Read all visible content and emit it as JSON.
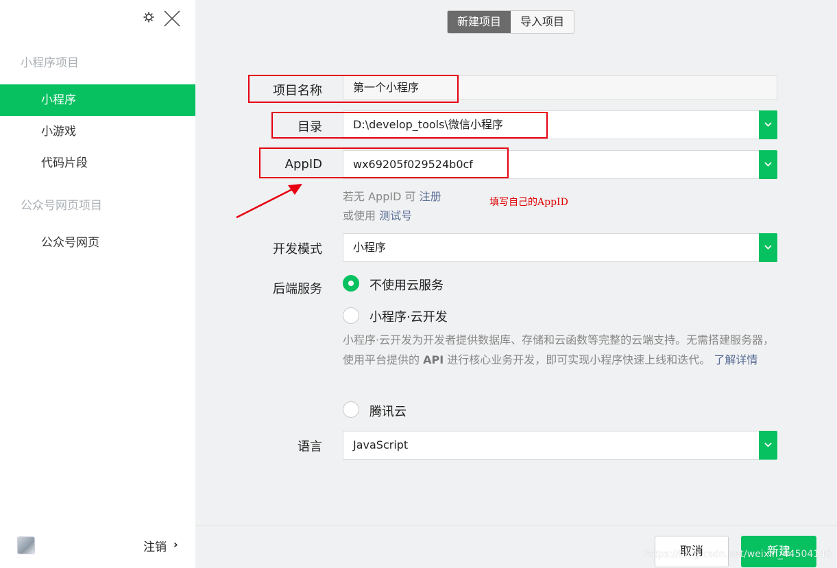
{
  "sidebar": {
    "section_mini_program": "小程序项目",
    "items_mini": [
      {
        "label": "小程序",
        "active": true
      },
      {
        "label": "小游戏",
        "active": false
      },
      {
        "label": "代码片段",
        "active": false
      }
    ],
    "section_official": "公众号网页项目",
    "items_official": [
      {
        "label": "公众号网页",
        "active": false
      }
    ],
    "logout_label": "注销",
    "logout_arrow": "›",
    "icons": [
      "gear-icon",
      "close-icon",
      "avatar"
    ]
  },
  "tabs": [
    {
      "label": "新建项目",
      "active": true
    },
    {
      "label": "导入项目",
      "active": false
    }
  ],
  "form": {
    "name_label": "项目名称",
    "name_value": "第一个小程序",
    "dir_label": "目录",
    "dir_value": "D:\\develop_tools\\微信小程序",
    "appid_label": "AppID",
    "appid_value": "wx69205f029524b0cf",
    "appid_hint_prefix": "若无",
    "appid_hint_appid": "AppID",
    "appid_hint_can": "可",
    "appid_hint_register": "注册",
    "appid_hint_or": "或使用",
    "appid_hint_test": "测试号",
    "annotation": "填写自己的AppID",
    "mode_label": "开发模式",
    "mode_value": "小程序",
    "backend_label": "后端服务",
    "backend_options": [
      {
        "label": "不使用云服务",
        "selected": true
      },
      {
        "label": "小程序·云开发",
        "selected": false
      },
      {
        "label": "腾讯云",
        "selected": false
      }
    ],
    "cloud_desc_1": "小程序·云开发为开发者提供数据库、存储和云函数等完整的云端支持。无需搭建服务器，使用平台提供的",
    "cloud_desc_api": "API",
    "cloud_desc_2": "进行核心业务开发，即可实现小程序快速上线和迭代。",
    "cloud_desc_link": "了解详情",
    "lang_label": "语言",
    "lang_value": "JavaScript"
  },
  "footer": {
    "cancel_label": "取消",
    "create_label": "新建",
    "watermark": "https://blog.csdn.net/weixin_44504146"
  },
  "colors": {
    "accent": "#07c160",
    "link": "#576b95",
    "annotation_red": "#e60012",
    "tab_active": "#6b6b6b"
  }
}
